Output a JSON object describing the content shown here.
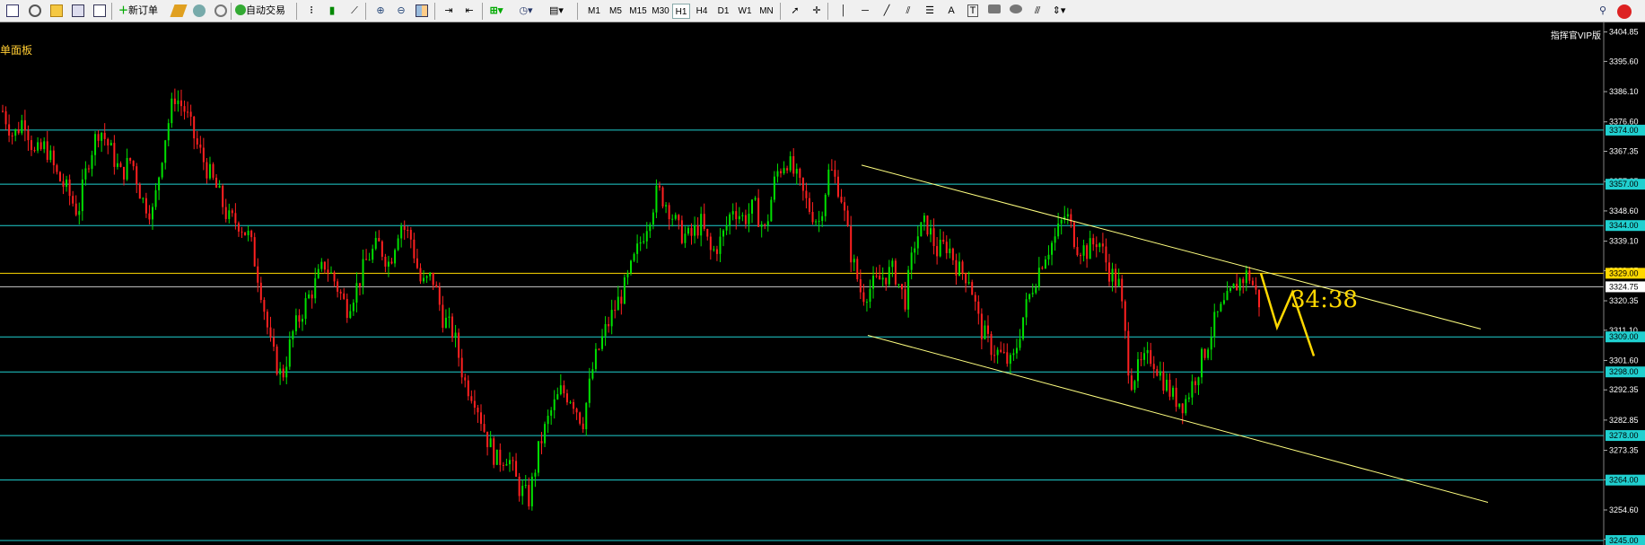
{
  "toolbar": {
    "new_order_label": "新订单",
    "auto_trade_label": "自动交易",
    "timeframes": [
      "M1",
      "M5",
      "M15",
      "M30",
      "H1",
      "H4",
      "D1",
      "W1",
      "MN"
    ],
    "active_timeframe": "H1",
    "tool_text_a": "A",
    "tool_text_t": "T"
  },
  "panel_label": "单面板",
  "vip_label": "指挥官VIP版",
  "countdown": "34:38",
  "colors": {
    "background": "#000000",
    "bull_candle": "#00e000",
    "bear_candle": "#ff2020",
    "horizontal_line": "#20d0d0",
    "trend_line": "#ffff80",
    "current_price_line": "#ffd800",
    "zigzag": "#ffd800",
    "axis_text": "#ffffff"
  },
  "price_axis": {
    "tick_labels": [
      "3404.85",
      "3395.60",
      "3386.10",
      "3376.60",
      "3367.35",
      "3357.85",
      "3348.60",
      "3339.10",
      "3329.85",
      "3320.35",
      "3311.10",
      "3301.60",
      "3292.35",
      "3282.85",
      "3273.35",
      "3264.10",
      "3254.60",
      "3245.35"
    ],
    "level_tags": [
      "3374.00",
      "3357.00",
      "3344.00",
      "3329.00",
      "3309.00",
      "3298.00",
      "3278.00",
      "3264.00",
      "3245.00"
    ],
    "current_price_tag": "3324.75"
  },
  "chart_data": {
    "type": "candlestick",
    "symbol": "",
    "timeframe": "H1",
    "y_range": [
      3245.0,
      3407.0
    ],
    "horizontal_levels": [
      3374.0,
      3357.0,
      3344.0,
      3309.0,
      3298.0,
      3278.0,
      3264.0,
      3245.0
    ],
    "resistance_level": 3329.0,
    "current_price": 3324.75,
    "trend_channel_prices": [
      [
        3363.0,
        3311.5
      ],
      [
        3309.5,
        3257.0
      ]
    ],
    "projected_path_prices": [
      3329.0,
      3312.0,
      3323.0,
      3303.0
    ],
    "price_path": [
      3380,
      3372,
      3378,
      3366,
      3369,
      3360,
      3355,
      3348,
      3365,
      3375,
      3368,
      3360,
      3365,
      3352,
      3348,
      3370,
      3385,
      3380,
      3370,
      3362,
      3355,
      3346,
      3345,
      3340,
      3325,
      3305,
      3296,
      3310,
      3318,
      3325,
      3332,
      3326,
      3318,
      3325,
      3334,
      3338,
      3332,
      3345,
      3340,
      3325,
      3328,
      3315,
      3310,
      3295,
      3290,
      3278,
      3270,
      3272,
      3262,
      3258,
      3275,
      3285,
      3292,
      3290,
      3282,
      3300,
      3310,
      3318,
      3325,
      3335,
      3345,
      3355,
      3350,
      3342,
      3340,
      3345,
      3335,
      3340,
      3350,
      3346,
      3350,
      3342,
      3360,
      3365,
      3358,
      3350,
      3345,
      3362,
      3355,
      3335,
      3322,
      3325,
      3328,
      3330,
      3320,
      3340,
      3345,
      3336,
      3338,
      3330,
      3328,
      3312,
      3306,
      3303,
      3300,
      3315,
      3326,
      3335,
      3340,
      3348,
      3338,
      3336,
      3340,
      3330,
      3325,
      3295,
      3300,
      3303,
      3296,
      3290,
      3288,
      3296,
      3305,
      3315,
      3320,
      3326,
      3329,
      3320
    ],
    "x_axis_labels": []
  }
}
